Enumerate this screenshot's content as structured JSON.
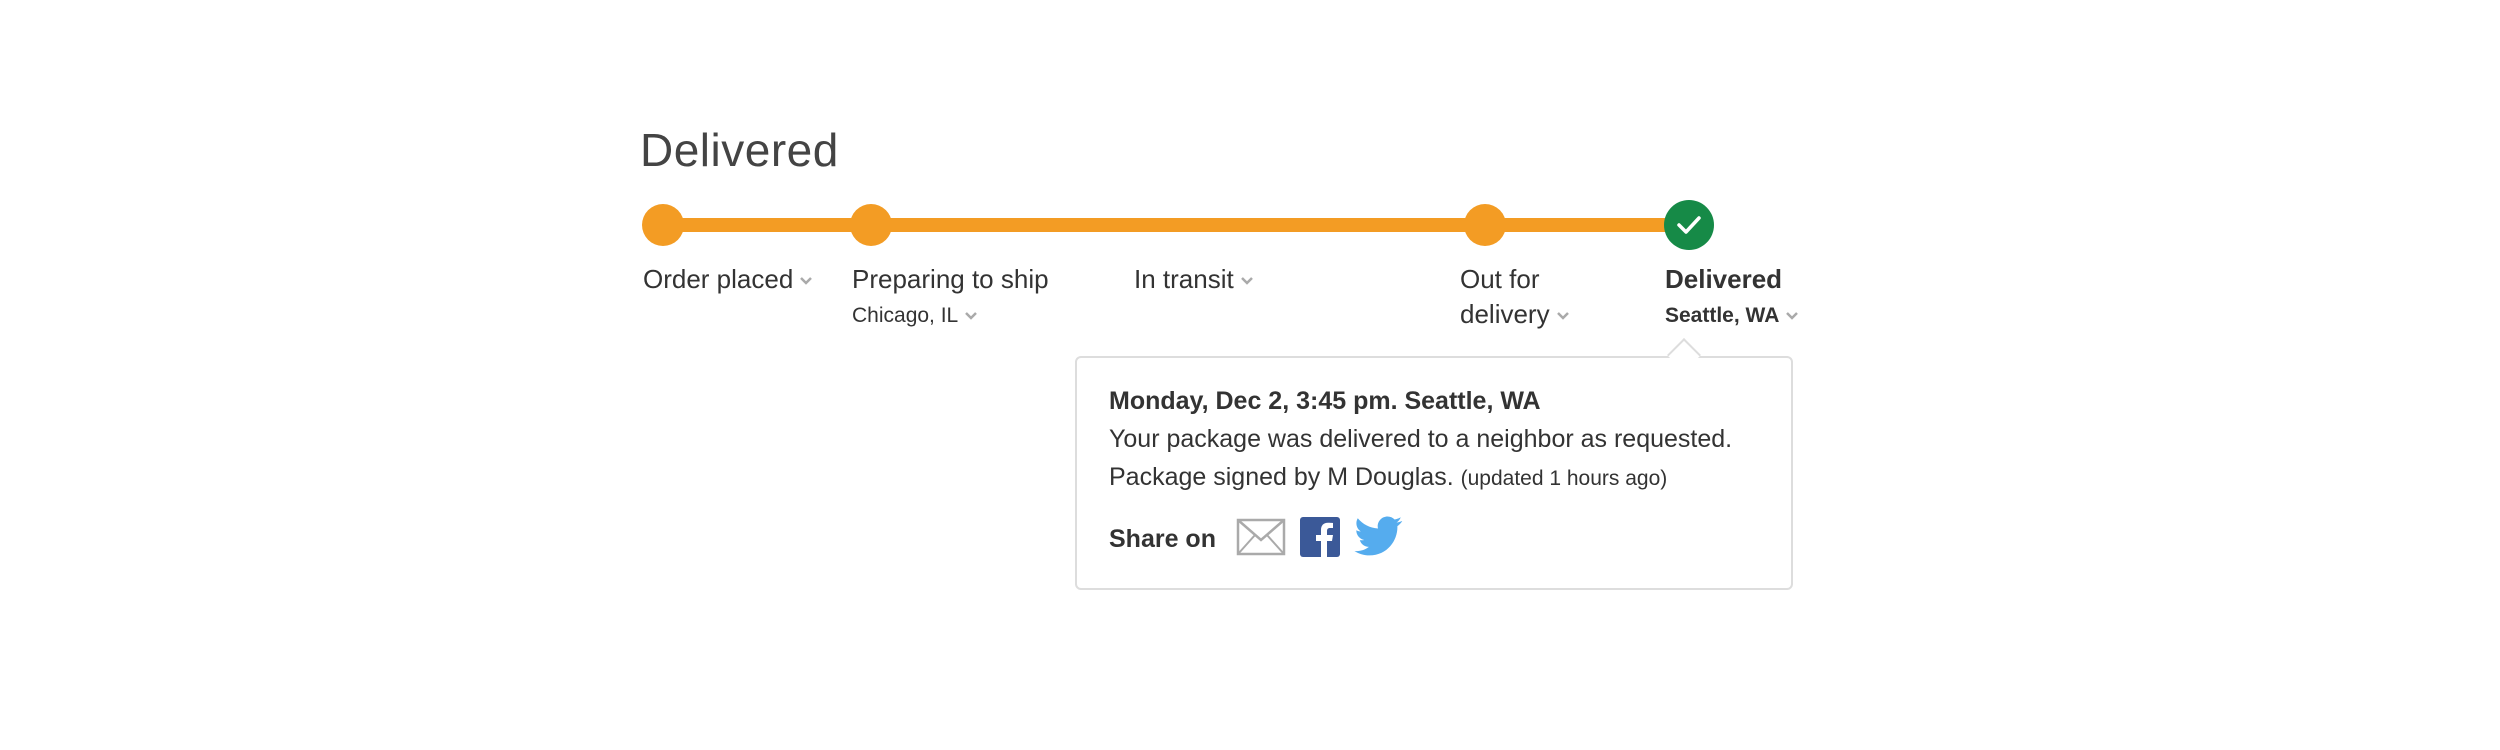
{
  "header": {
    "title": "Delivered"
  },
  "steps": [
    {
      "label": "Order placed",
      "sub": ""
    },
    {
      "label": "Preparing to ship",
      "sub": "Chicago, IL"
    },
    {
      "label": "In transit",
      "sub": ""
    },
    {
      "label_line1": "Out for",
      "label_line2": "delivery",
      "sub": ""
    },
    {
      "label": "Delivered",
      "sub": "Seattle, WA"
    }
  ],
  "progress": {
    "completed_steps": 5,
    "total_steps": 5,
    "current_step": "Delivered"
  },
  "popover": {
    "heading": "Monday, Dec 2, 3:45 pm. Seattle, WA",
    "message": "Your package was delivered to a neighbor as requested.",
    "signed": "Package signed by M Douglas.",
    "updated": "(updated 1 hours ago)",
    "share_label": "Share on"
  },
  "icons": {
    "step_chevron": "chevron-down-icon",
    "check": "check-icon",
    "email": "email-icon",
    "facebook": "facebook-icon",
    "twitter": "twitter-icon"
  },
  "colors": {
    "progress": "#f39c24",
    "complete": "#168a47",
    "facebook": "#3b5998",
    "twitter": "#55acee"
  }
}
